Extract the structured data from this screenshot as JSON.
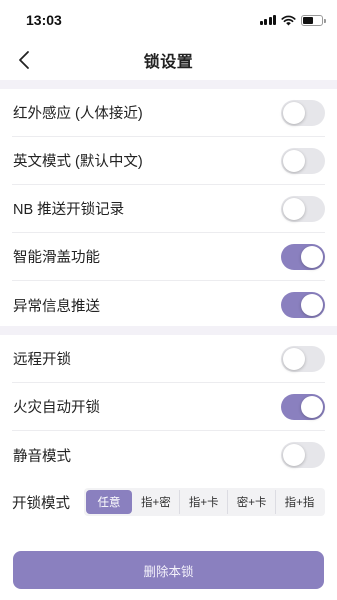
{
  "status_bar": {
    "time": "13:03"
  },
  "nav": {
    "title": "锁设置"
  },
  "section1": [
    {
      "label": "红外感应 (人体接近)",
      "on": false
    },
    {
      "label": "英文模式 (默认中文)",
      "on": false
    },
    {
      "label": "NB 推送开锁记录",
      "on": false
    },
    {
      "label": "智能滑盖功能",
      "on": true
    },
    {
      "label": "异常信息推送",
      "on": true
    }
  ],
  "section2": [
    {
      "label": "远程开锁",
      "on": false
    },
    {
      "label": "火灾自动开锁",
      "on": true
    },
    {
      "label": "静音模式",
      "on": false
    }
  ],
  "unlock_mode": {
    "label": "开锁模式",
    "options": [
      "任意",
      "指+密",
      "指+卡",
      "密+卡",
      "指+指"
    ],
    "selected": "任意"
  },
  "delete_button": {
    "label": "删除本锁"
  },
  "colors": {
    "accent": "#8a80bf",
    "toggle_off": "#e6e6ea",
    "section_gap": "#f3f1f7"
  }
}
